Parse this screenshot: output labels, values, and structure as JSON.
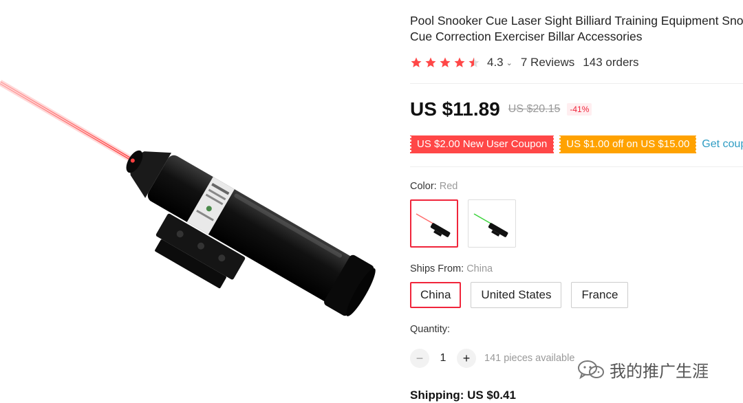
{
  "product": {
    "title": "Pool Snooker Cue Laser Sight Billiard Training Equipment Snooker Cue Correction Exerciser Billar Accessories",
    "rating": "4.3",
    "rating_stars": 4.3,
    "reviews": "7 Reviews",
    "orders": "143 orders"
  },
  "price": {
    "current": "US $11.89",
    "original": "US $20.15",
    "discount": "-41%"
  },
  "coupons": {
    "new_user": "US $2.00 New User Coupon",
    "spend_off": "US $1.00 off on US $15.00",
    "get_label": "Get coupons"
  },
  "color": {
    "label": "Color:",
    "selected": "Red",
    "options": [
      "red",
      "green"
    ]
  },
  "ships_from": {
    "label": "Ships From:",
    "selected": "China",
    "options": [
      "China",
      "United States",
      "France"
    ]
  },
  "quantity": {
    "label": "Quantity:",
    "value": "1",
    "minus": "−",
    "plus": "+",
    "available": "141 pieces available"
  },
  "shipping": {
    "text": "Shipping: US $0.41"
  },
  "watermark": {
    "text": "我的推广生涯"
  },
  "colors": {
    "accent_red": "#f0243a",
    "coupon_red": "#ff4747",
    "coupon_orange": "#ffa200",
    "star": "#ff4747",
    "link": "#2e9cc3"
  }
}
